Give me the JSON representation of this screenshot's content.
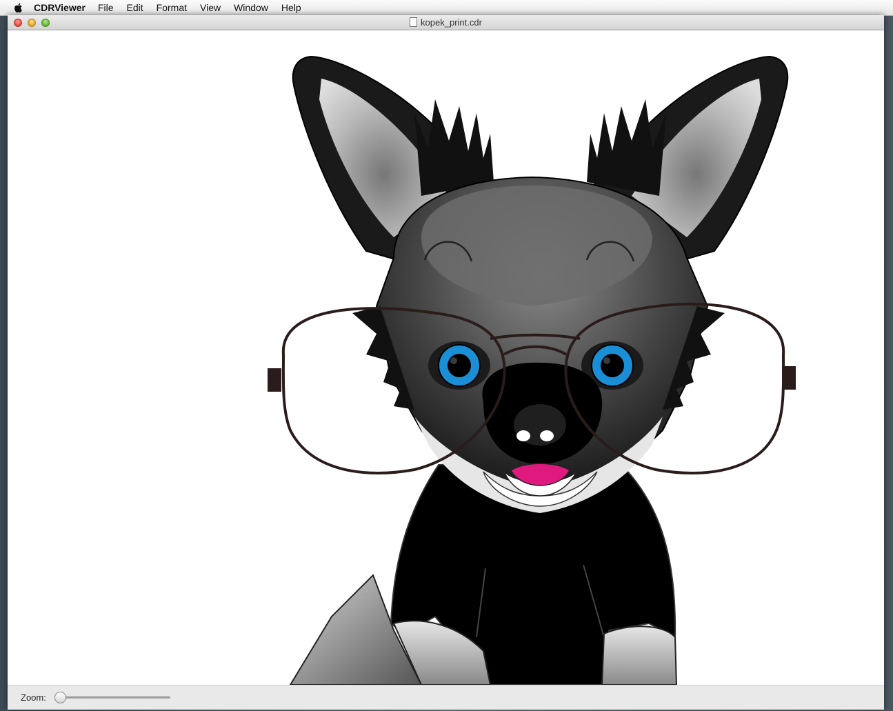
{
  "menubar": {
    "app_name": "CDRViewer",
    "items": [
      "File",
      "Edit",
      "Format",
      "View",
      "Window",
      "Help"
    ]
  },
  "window": {
    "title": "kopek_print.cdr"
  },
  "bottom_bar": {
    "zoom_label": "Zoom:",
    "zoom_value": 0
  },
  "colors": {
    "eye": "#1a8fd6",
    "tongue": "#e0197f",
    "glasses": "#2a1c1a"
  }
}
